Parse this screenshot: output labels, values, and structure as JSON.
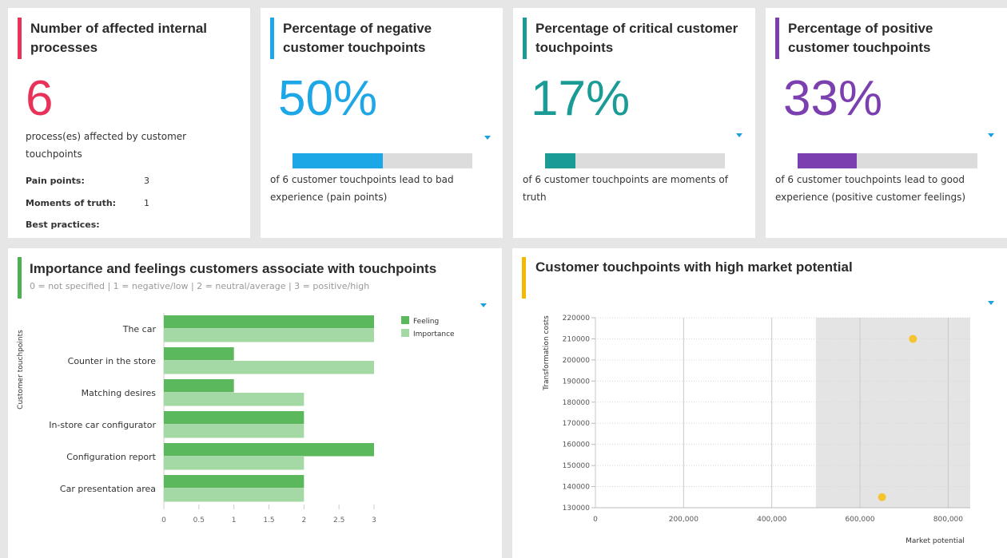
{
  "kpi_cards": [
    {
      "title": "Number of affected internal processes",
      "value": "6",
      "description": "process(es) affected by customer touchpoints",
      "details": [
        {
          "label": "Pain points:",
          "value": "3"
        },
        {
          "label": "Moments of truth:",
          "value": "1"
        },
        {
          "label": "Best practices:",
          "value": ""
        }
      ],
      "accent_color": "#e8325a"
    },
    {
      "title": "Percentage of negative customer touchpoints",
      "value": "50%",
      "progress": 0.5,
      "description": "of 6 customer touchpoints lead to bad experience (pain points)",
      "accent_color": "#1ea7e6"
    },
    {
      "title": "Percentage of critical customer touchpoints",
      "value": "17%",
      "progress": 0.17,
      "description": "of 6 customer touchpoints are moments of truth",
      "accent_color": "#1a9b96"
    },
    {
      "title": "Percentage of positive customer touchpoints",
      "value": "33%",
      "progress": 0.33,
      "description": "of 6 customer touchpoints lead to good experience (positive customer feelings)",
      "accent_color": "#7b3fb0"
    }
  ],
  "bar_panel": {
    "title": "Importance and feelings customers associate with touchpoints",
    "subtitle": "0 = not specified | 1 = negative/low | 2 = neutral/average | 3 = positive/high",
    "accent_color": "#4caf50"
  },
  "scatter_panel": {
    "title": "Customer touchpoints with high market potential",
    "accent_color": "#f5b800"
  },
  "chart_data": [
    {
      "type": "bar",
      "orientation": "horizontal",
      "categories": [
        "The car",
        "Counter in the store",
        "Matching desires",
        "In-store car configurator",
        "Configuration report",
        "Car presentation area"
      ],
      "series": [
        {
          "name": "Feeling",
          "values": [
            3,
            1,
            1,
            2,
            3,
            2
          ],
          "color": "#5cb85c"
        },
        {
          "name": "Importance",
          "values": [
            3,
            3,
            2,
            2,
            2,
            2
          ],
          "color": "#a4d8a4"
        }
      ],
      "ylabel": "Customer touchpoints",
      "xlim": [
        0,
        3
      ],
      "x_ticks": [
        "0",
        "0.5",
        "1",
        "1.5",
        "2",
        "2.5",
        "3"
      ],
      "legend": "top-right",
      "grid": false
    },
    {
      "type": "scatter",
      "points": [
        {
          "x": 720000,
          "y": 210000
        },
        {
          "x": 650000,
          "y": 135000
        }
      ],
      "point_color": "#f5c431",
      "xlabel": "Market potential",
      "ylabel": "Transformation costs",
      "xlim": [
        0,
        850000
      ],
      "ylim": [
        130000,
        220000
      ],
      "x_ticks": [
        "0",
        "200,000",
        "400,000",
        "600,000",
        "800,000"
      ],
      "y_ticks": [
        "220000",
        "210000",
        "200000",
        "190000",
        "180000",
        "170000",
        "160000",
        "150000",
        "140000",
        "130000"
      ],
      "highlight_region_x": [
        500000,
        850000
      ],
      "highlight_color": "#e4e4e4",
      "grid": true
    }
  ]
}
